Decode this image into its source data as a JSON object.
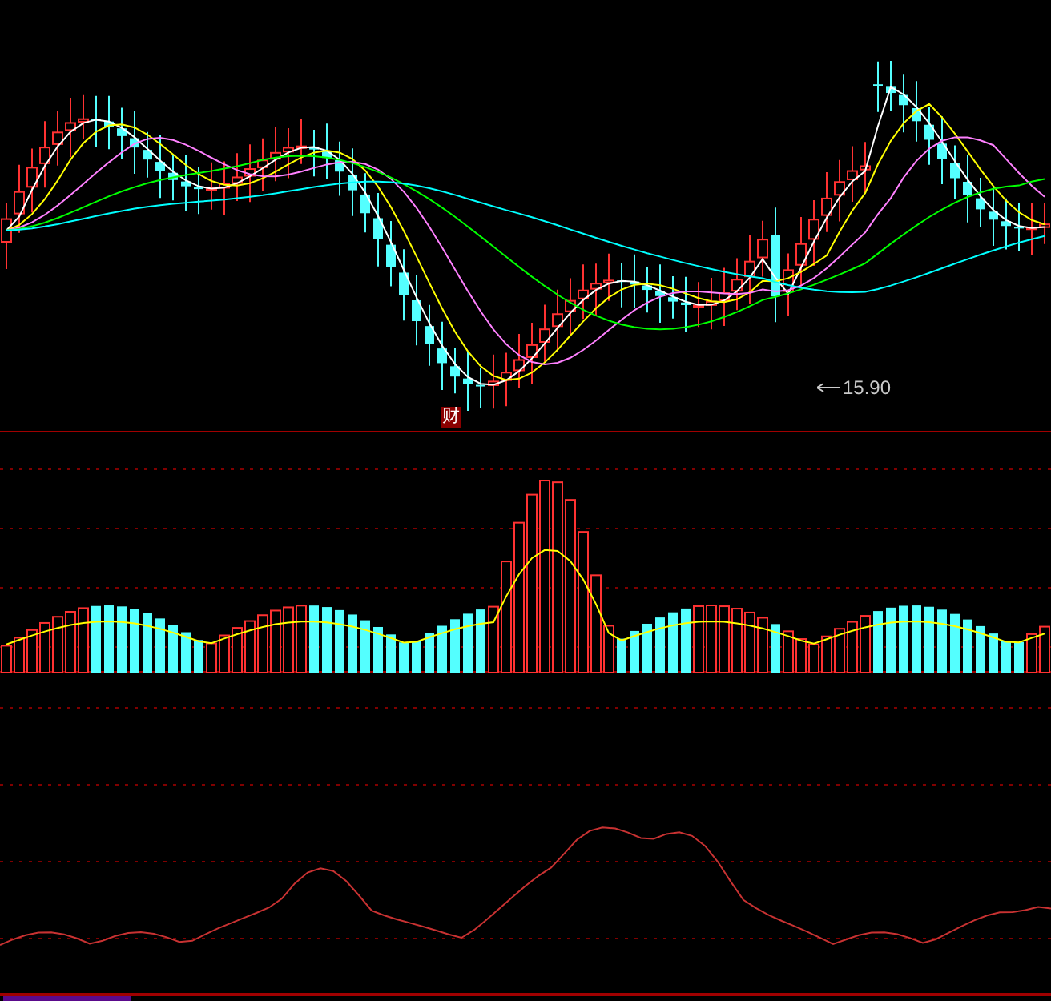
{
  "price_panel": {
    "low_marker": {
      "label": "15.90"
    }
  },
  "event_badge": {
    "label": "财"
  }
}
